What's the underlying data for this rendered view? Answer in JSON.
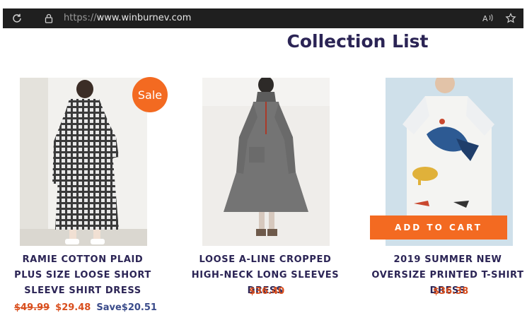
{
  "browser": {
    "url_protocol": "https://",
    "url_host": "www.winburnev.com"
  },
  "page": {
    "title": "Collection List"
  },
  "products": [
    {
      "name": "RAMIE COTTON PLAID PLUS SIZE LOOSE SHORT SLEEVE SHIRT DRESS",
      "badge": "Sale",
      "old_price": "$49.99",
      "price": "$29.48",
      "save": "Save$20.51"
    },
    {
      "name": "LOOSE A-LINE CROPPED HIGH-NECK LONG SLEEVES DRESS",
      "price": "$36.40"
    },
    {
      "name": "2019 SUMMER NEW OVERSIZE PRINTED T-SHIRT DRESS",
      "price": "$36.38",
      "cta": "ADD TO CART"
    }
  ],
  "colors": {
    "accent": "#f36a21",
    "title": "#2b2455",
    "price": "#d94f1e",
    "browser_bar": "#1f1f1f"
  },
  "icons": [
    "reload-icon",
    "lock-icon",
    "read-aloud-icon",
    "favorite-star-icon"
  ]
}
